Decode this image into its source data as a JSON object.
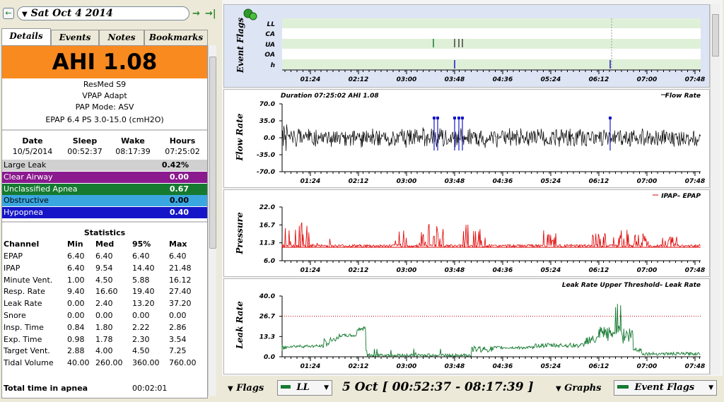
{
  "date_bar": {
    "date_text": "Sat Oct 4 2014",
    "prev_icon": "left-arrow-circle-icon",
    "next_icon": "right-arrow-icon",
    "last_icon": "skip-to-end-icon"
  },
  "tabs": [
    {
      "label": "Details",
      "active": true
    },
    {
      "label": "Events",
      "active": false
    },
    {
      "label": "Notes",
      "active": false
    },
    {
      "label": "Bookmarks",
      "active": false
    }
  ],
  "summary": {
    "ahi_text": "AHI 1.08",
    "ahi_color": "#f98a1f",
    "machine": "ResMed S9",
    "device": "VPAP Adapt",
    "mode": "PAP Mode: ASV",
    "settings": "EPAP 6.4 PS 3.0-15.0 (cmH2O)"
  },
  "session": {
    "headers": [
      "Date",
      "Sleep",
      "Wake",
      "Hours"
    ],
    "values": [
      "10/5/2014",
      "00:52:37",
      "08:17:39",
      "07:25:02"
    ]
  },
  "events": [
    {
      "label": "Large Leak",
      "value": "0.42%",
      "bg": "#d0d0d0",
      "fg": "#000000"
    },
    {
      "label": "Clear Airway",
      "value": "0.00",
      "bg": "#8b1a8f",
      "fg": "#ffffff"
    },
    {
      "label": "Unclassified Apnea",
      "value": "0.67",
      "bg": "#157a30",
      "fg": "#ffffff"
    },
    {
      "label": "Obstructive",
      "value": "0.00",
      "bg": "#3aa7e0",
      "fg": "#000000"
    },
    {
      "label": "Hypopnea",
      "value": "0.40",
      "bg": "#1616c8",
      "fg": "#ffffff"
    }
  ],
  "statistics": {
    "title": "Statistics",
    "headers": [
      "Channel",
      "Min",
      "Med",
      "95%",
      "Max"
    ],
    "rows": [
      [
        "EPAP",
        "6.40",
        "6.40",
        "6.40",
        "6.40"
      ],
      [
        "IPAP",
        "6.40",
        "9.54",
        "14.40",
        "21.48"
      ],
      [
        "Minute Vent.",
        "1.00",
        "4.50",
        "5.88",
        "16.12"
      ],
      [
        "Resp. Rate",
        "9.40",
        "16.60",
        "19.40",
        "27.40"
      ],
      [
        "Leak Rate",
        "0.00",
        "2.40",
        "13.20",
        "37.20"
      ],
      [
        "Snore",
        "0.00",
        "0.00",
        "0.00",
        "0.00"
      ],
      [
        "Insp. Time",
        "0.84",
        "1.80",
        "2.22",
        "2.86"
      ],
      [
        "Exp. Time",
        "0.98",
        "1.78",
        "2.30",
        "3.54"
      ],
      [
        "Target Vent.",
        "2.88",
        "4.00",
        "4.50",
        "7.25"
      ],
      [
        "Tidal Volume",
        "40.00",
        "260.00",
        "360.00",
        "760.00"
      ]
    ],
    "total_apnea_label": "Total time in apnea",
    "total_apnea_value": "00:02:01"
  },
  "time_ticks": [
    "01:24",
    "02:12",
    "03:00",
    "03:48",
    "04:36",
    "05:24",
    "06:12",
    "07:00",
    "07:48"
  ],
  "graphs": {
    "event_flags": {
      "ylabel": "Event Flags",
      "rows": [
        "LL",
        "CA",
        "UA",
        "OA",
        "h"
      ],
      "pin_icon": "pin-icon"
    },
    "flow_rate": {
      "ylabel": "Flow Rate",
      "header_left": "Duration 07:25:02 AHI 1.08",
      "legend": "Flow Rate",
      "yticks": [
        "70.0",
        "35.0",
        "0.0",
        "-35.0",
        "-70.0"
      ]
    },
    "pressure": {
      "ylabel": "Pressure",
      "legend": "IPAP",
      "legend2": "EPAP",
      "yticks": [
        "22.0",
        "16.7",
        "11.3",
        "6.0"
      ]
    },
    "leak_rate": {
      "ylabel": "Leak Rate",
      "legend_threshold": "Leak Rate Upper Threshold",
      "legend": "Leak Rate",
      "yticks": [
        "40.0",
        "26.7",
        "13.3",
        "0.0"
      ]
    }
  },
  "bottom_bar": {
    "flags_label": "Flags",
    "flags_combo": "LL",
    "range_text": "5 Oct [ 00:52:37 - 08:17:39 ]",
    "graphs_label": "Graphs",
    "graphs_combo": "Event Flags"
  }
}
